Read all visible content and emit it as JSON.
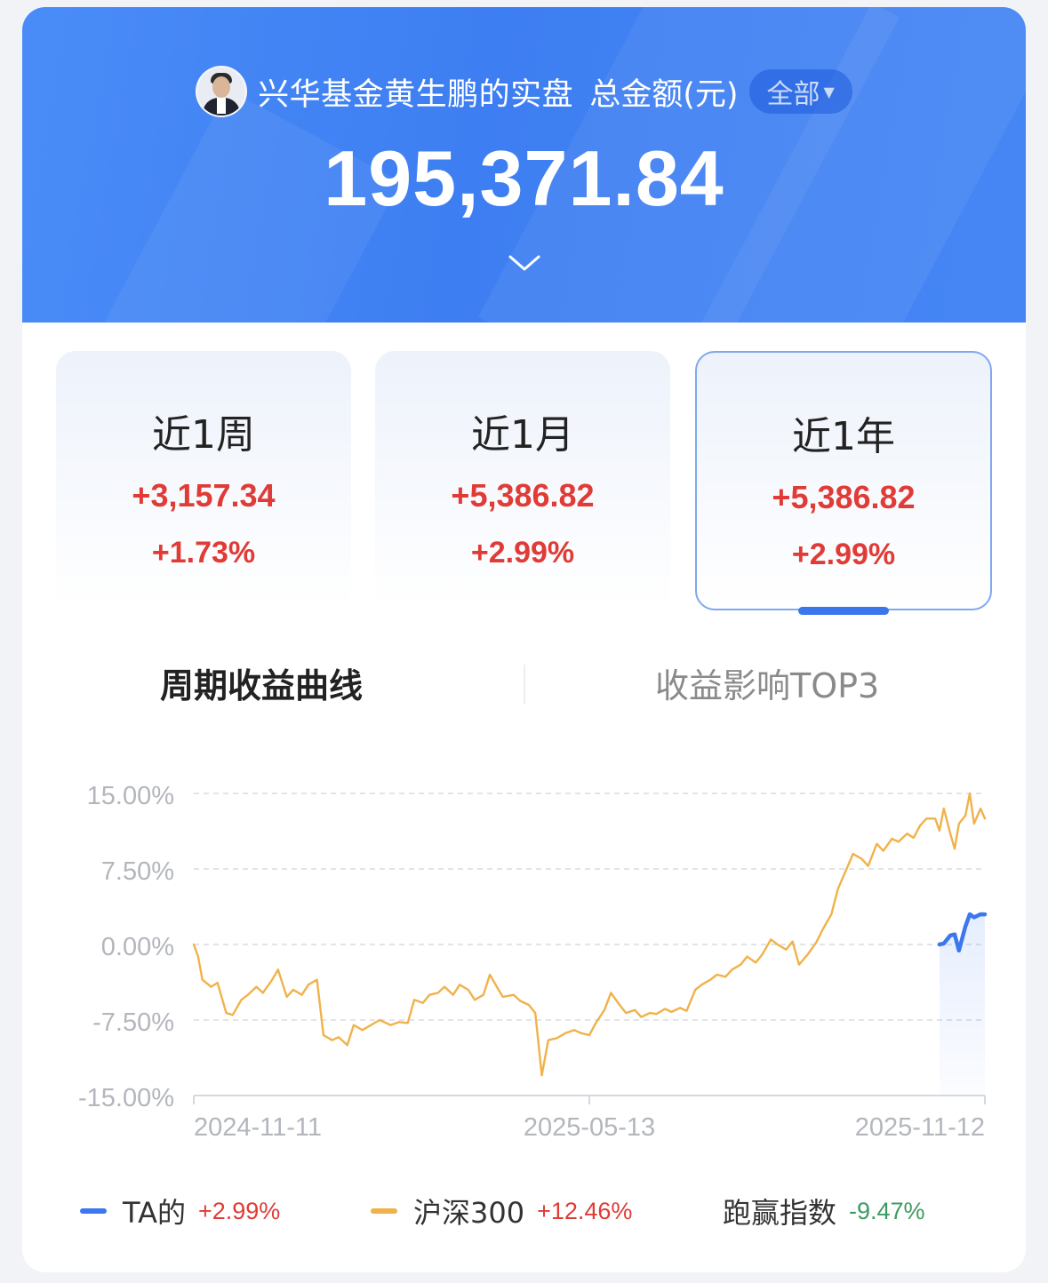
{
  "header": {
    "name": "兴华基金黄生鹏的实盘",
    "unit_label": "总金额(元)",
    "scope_selector": "全部",
    "total_amount": "195,371.84"
  },
  "periods": [
    {
      "label": "近1周",
      "amount": "+3,157.34",
      "pct": "+1.73%",
      "selected": false
    },
    {
      "label": "近1月",
      "amount": "+5,386.82",
      "pct": "+2.99%",
      "selected": false
    },
    {
      "label": "近1年",
      "amount": "+5,386.82",
      "pct": "+2.99%",
      "selected": true
    }
  ],
  "tabs": {
    "active": "周期收益曲线",
    "inactive": "收益影响TOP3"
  },
  "colors": {
    "accent": "#3a77ec",
    "gain": "#e03b36",
    "loss": "#3f9a62",
    "benchmark": "#f0b24a",
    "series_ta": "#3b77ee"
  },
  "chart_data": {
    "type": "line",
    "y_ticks": [
      "15.00%",
      "7.50%",
      "0.00%",
      "-7.50%",
      "-15.00%"
    ],
    "ylim": [
      -15,
      15
    ],
    "x_ticks": [
      "2024-11-11",
      "2025-05-13",
      "2025-11-12"
    ],
    "x_start": "2024-11-11",
    "x_end": "2025-11-12",
    "grid": true,
    "series": [
      {
        "name": "沪深300",
        "color": "#f0b24a",
        "points": [
          [
            "2024-11-11",
            0.0
          ],
          [
            "2024-11-13",
            -1.2
          ],
          [
            "2024-11-15",
            -3.5
          ],
          [
            "2024-11-19",
            -4.2
          ],
          [
            "2024-11-22",
            -3.8
          ],
          [
            "2024-11-26",
            -6.8
          ],
          [
            "2024-11-29",
            -7.0
          ],
          [
            "2024-12-03",
            -5.5
          ],
          [
            "2024-12-06",
            -5.0
          ],
          [
            "2024-12-10",
            -4.2
          ],
          [
            "2024-12-13",
            -4.8
          ],
          [
            "2024-12-17",
            -3.6
          ],
          [
            "2024-12-20",
            -2.5
          ],
          [
            "2024-12-24",
            -5.2
          ],
          [
            "2024-12-27",
            -4.5
          ],
          [
            "2024-12-31",
            -5.0
          ],
          [
            "2025-01-03",
            -4.0
          ],
          [
            "2025-01-07",
            -3.5
          ],
          [
            "2025-01-10",
            -9.0
          ],
          [
            "2025-01-14",
            -9.5
          ],
          [
            "2025-01-17",
            -9.2
          ],
          [
            "2025-01-21",
            -10.0
          ],
          [
            "2025-01-24",
            -8.0
          ],
          [
            "2025-01-28",
            -8.5
          ],
          [
            "2025-02-05",
            -7.5
          ],
          [
            "2025-02-10",
            -8.0
          ],
          [
            "2025-02-14",
            -7.7
          ],
          [
            "2025-02-18",
            -7.8
          ],
          [
            "2025-02-21",
            -5.5
          ],
          [
            "2025-02-25",
            -5.8
          ],
          [
            "2025-02-28",
            -5.0
          ],
          [
            "2025-03-04",
            -4.8
          ],
          [
            "2025-03-07",
            -4.2
          ],
          [
            "2025-03-11",
            -5.0
          ],
          [
            "2025-03-14",
            -4.0
          ],
          [
            "2025-03-18",
            -4.5
          ],
          [
            "2025-03-21",
            -5.5
          ],
          [
            "2025-03-25",
            -5.0
          ],
          [
            "2025-03-28",
            -3.0
          ],
          [
            "2025-04-01",
            -4.5
          ],
          [
            "2025-04-03",
            -5.2
          ],
          [
            "2025-04-08",
            -5.0
          ],
          [
            "2025-04-11",
            -5.6
          ],
          [
            "2025-04-15",
            -6.0
          ],
          [
            "2025-04-18",
            -6.8
          ],
          [
            "2025-04-21",
            -13.0
          ],
          [
            "2025-04-24",
            -9.5
          ],
          [
            "2025-04-28",
            -9.3
          ],
          [
            "2025-05-02",
            -8.8
          ],
          [
            "2025-05-06",
            -8.5
          ],
          [
            "2025-05-09",
            -8.8
          ],
          [
            "2025-05-13",
            -9.0
          ],
          [
            "2025-05-16",
            -7.8
          ],
          [
            "2025-05-20",
            -6.5
          ],
          [
            "2025-05-23",
            -4.8
          ],
          [
            "2025-05-27",
            -6.0
          ],
          [
            "2025-05-30",
            -6.8
          ],
          [
            "2025-06-03",
            -6.5
          ],
          [
            "2025-06-06",
            -7.2
          ],
          [
            "2025-06-10",
            -6.8
          ],
          [
            "2025-06-13",
            -6.9
          ],
          [
            "2025-06-17",
            -6.4
          ],
          [
            "2025-06-20",
            -6.7
          ],
          [
            "2025-06-24",
            -6.3
          ],
          [
            "2025-06-27",
            -6.6
          ],
          [
            "2025-07-01",
            -4.5
          ],
          [
            "2025-07-04",
            -4.0
          ],
          [
            "2025-07-08",
            -3.5
          ],
          [
            "2025-07-11",
            -3.0
          ],
          [
            "2025-07-15",
            -3.2
          ],
          [
            "2025-07-18",
            -2.5
          ],
          [
            "2025-07-22",
            -2.0
          ],
          [
            "2025-07-25",
            -1.2
          ],
          [
            "2025-07-29",
            -1.8
          ],
          [
            "2025-08-01",
            -1.0
          ],
          [
            "2025-08-05",
            0.5
          ],
          [
            "2025-08-08",
            0.0
          ],
          [
            "2025-08-12",
            -0.5
          ],
          [
            "2025-08-15",
            0.3
          ],
          [
            "2025-08-18",
            -2.0
          ],
          [
            "2025-08-22",
            -1.0
          ],
          [
            "2025-08-26",
            0.2
          ],
          [
            "2025-08-29",
            1.5
          ],
          [
            "2025-09-02",
            3.0
          ],
          [
            "2025-09-05",
            5.5
          ],
          [
            "2025-09-09",
            7.5
          ],
          [
            "2025-09-12",
            9.0
          ],
          [
            "2025-09-16",
            8.5
          ],
          [
            "2025-09-19",
            7.8
          ],
          [
            "2025-09-23",
            10.0
          ],
          [
            "2025-09-26",
            9.3
          ],
          [
            "2025-09-30",
            10.5
          ],
          [
            "2025-10-03",
            10.2
          ],
          [
            "2025-10-07",
            11.0
          ],
          [
            "2025-10-10",
            10.6
          ],
          [
            "2025-10-13",
            11.8
          ],
          [
            "2025-10-16",
            12.5
          ],
          [
            "2025-10-20",
            12.5
          ],
          [
            "2025-10-22",
            11.3
          ],
          [
            "2025-10-24",
            13.5
          ],
          [
            "2025-10-27",
            11.0
          ],
          [
            "2025-10-29",
            9.5
          ],
          [
            "2025-10-31",
            12.0
          ],
          [
            "2025-11-03",
            12.8
          ],
          [
            "2025-11-05",
            15.0
          ],
          [
            "2025-11-07",
            12.0
          ],
          [
            "2025-11-10",
            13.5
          ],
          [
            "2025-11-12",
            12.5
          ]
        ]
      },
      {
        "name": "TA的",
        "color": "#3b77ee",
        "points": [
          [
            "2025-10-22",
            0.0
          ],
          [
            "2025-10-24",
            0.1
          ],
          [
            "2025-10-27",
            0.9
          ],
          [
            "2025-10-29",
            1.0
          ],
          [
            "2025-10-31",
            -0.6
          ],
          [
            "2025-11-03",
            1.8
          ],
          [
            "2025-11-05",
            3.0
          ],
          [
            "2025-11-07",
            2.7
          ],
          [
            "2025-11-10",
            3.0
          ],
          [
            "2025-11-12",
            2.99
          ]
        ]
      }
    ]
  },
  "legend": [
    {
      "name": "TA的",
      "value": "+2.99%",
      "color": "#3b77ee",
      "value_color": "#e03b36"
    },
    {
      "name": "沪深300",
      "value": "+12.46%",
      "color": "#f0b24a",
      "value_color": "#e03b36"
    },
    {
      "name": "跑赢指数",
      "value": "-9.47%",
      "color": "",
      "value_color": "#3f9a62"
    }
  ]
}
